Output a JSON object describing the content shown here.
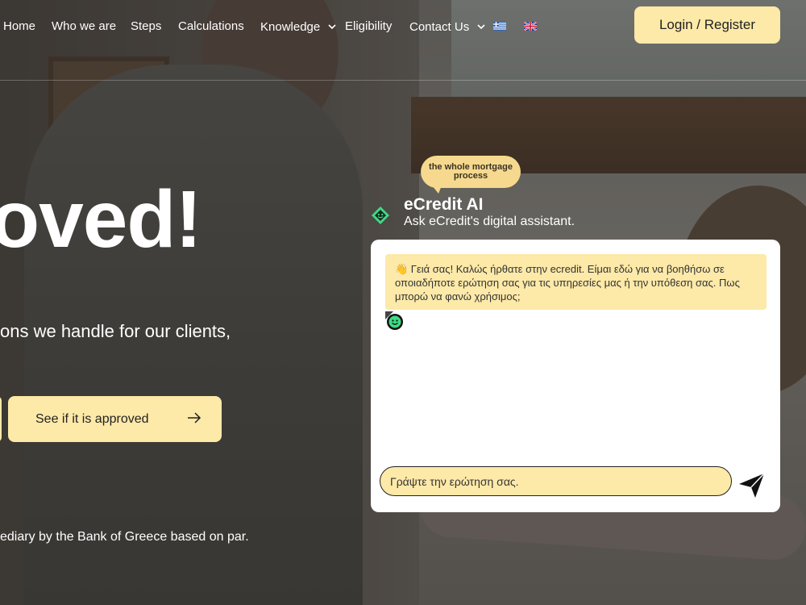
{
  "nav": {
    "items": [
      {
        "label": "Home"
      },
      {
        "label": "Who we are"
      },
      {
        "label": "Steps"
      },
      {
        "label": "Calculations"
      },
      {
        "label": "Knowledge"
      },
      {
        "label": "Eligibility"
      },
      {
        "label": "Contact Us"
      }
    ],
    "languages": [
      "greek-flag",
      "uk-flag"
    ],
    "login_label": "Login / Register"
  },
  "hero": {
    "title": "oved!",
    "subtitle": "ons we handle for our clients,",
    "cta_label": "See if it is approved",
    "footnote": "ediary by the Bank of Greece based on par."
  },
  "chat": {
    "bubble_text": "the whole mortgage process",
    "title": "eCredit AI",
    "subtitle": "Ask eCredit's digital assistant.",
    "message": "👋 Γειά σας! Καλώς ήρθατε στην ecredit. Είμαι εδώ για να βοηθήσω σε οποιαδήποτε ερώτηση σας για τις υπηρεσίες μας ή την υπόθεση σας. Πως μπορώ να φανώ χρήσιμος;",
    "input_placeholder": "Γράψτε την ερώτηση σας.",
    "icons": {
      "logo": "ecredit-logo-icon",
      "send": "send-icon"
    }
  },
  "colors": {
    "accent": "#fde9a8",
    "bubble": "#f6d98e",
    "logo_green": "#3ddc84"
  }
}
